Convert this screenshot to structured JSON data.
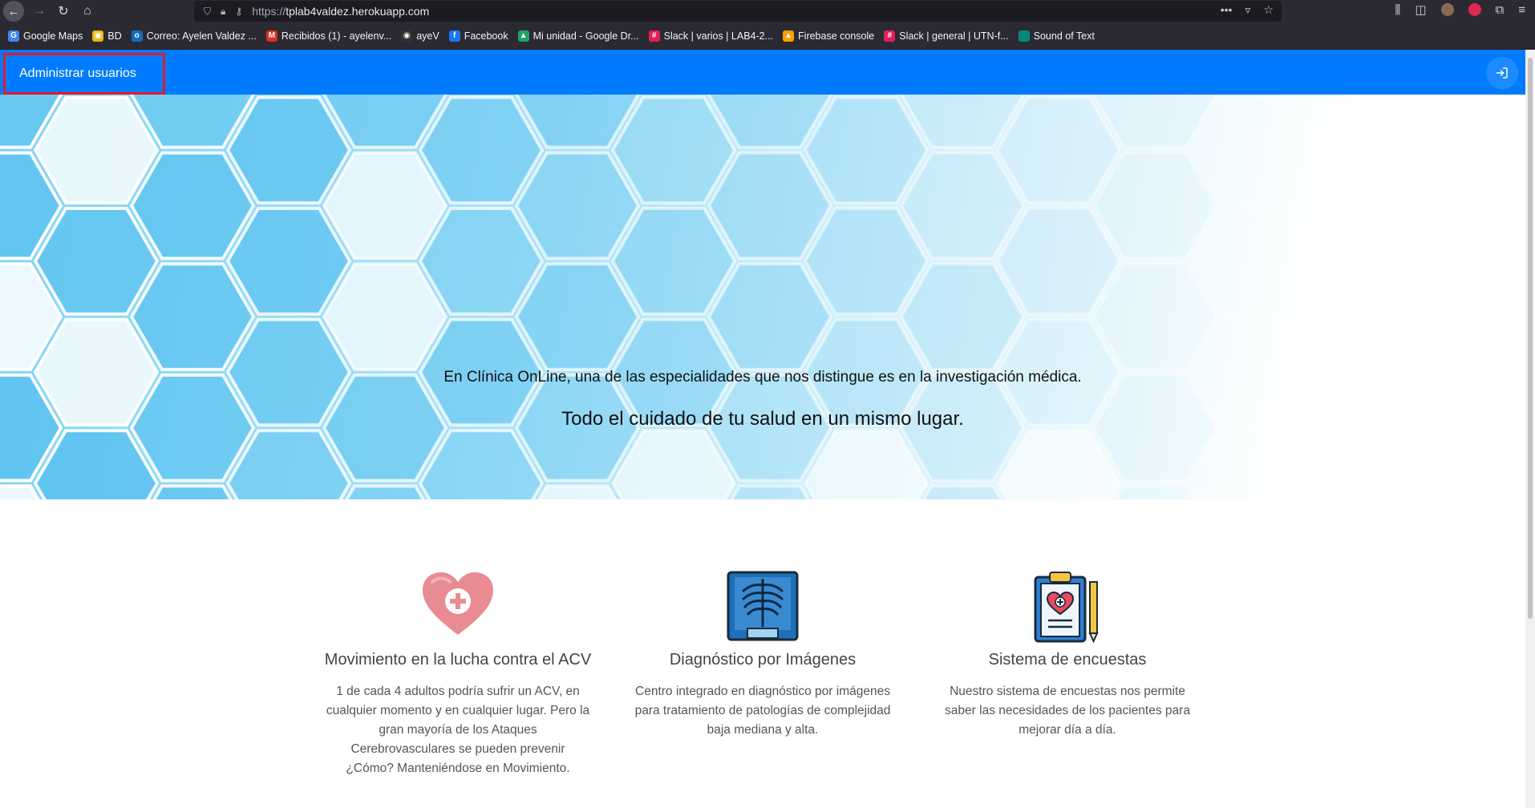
{
  "browser": {
    "url_prefix": "https://",
    "url_host": "tplab4valdez.herokuapp.com",
    "bookmarks": [
      {
        "label": "Google Maps",
        "color": "#4285f4",
        "glyph": "G"
      },
      {
        "label": "BD",
        "color": "#e8b70f",
        "glyph": "▣"
      },
      {
        "label": "Correo: Ayelen Valdez ...",
        "color": "#0f6cbd",
        "glyph": "o"
      },
      {
        "label": "Recibidos (1) - ayelenv...",
        "color": "#d93025",
        "glyph": "M"
      },
      {
        "label": "ayeV",
        "color": "#333",
        "glyph": "◉"
      },
      {
        "label": "Facebook",
        "color": "#1877f2",
        "glyph": "f"
      },
      {
        "label": "Mi unidad - Google Dr...",
        "color": "#1fa463",
        "glyph": "▲"
      },
      {
        "label": "Slack | varios | LAB4-2...",
        "color": "#e01e5a",
        "glyph": "#"
      },
      {
        "label": "Firebase console",
        "color": "#ffa000",
        "glyph": "▲"
      },
      {
        "label": "Slack | general | UTN-f...",
        "color": "#e01e5a",
        "glyph": "#"
      },
      {
        "label": "Sound of Text",
        "color": "#00897b",
        "glyph": " "
      }
    ]
  },
  "navbar": {
    "manage_users": "Administrar usuarios"
  },
  "hero": {
    "subtitle": "En Clínica OnLine, una de las especialidades que nos distingue es en la investigación médica.",
    "title": "Todo el cuidado de tu salud en un mismo lugar."
  },
  "features": [
    {
      "icon": "heart-plus-icon",
      "title": "Movimiento en la lucha contra el ACV",
      "text": "1 de cada 4 adultos podría sufrir un ACV, en cualquier momento y en cualquier lugar. Pero la gran mayoría de los Ataques Cerebrovasculares se pueden prevenir ¿Cómo? Manteniéndose en Movimiento."
    },
    {
      "icon": "xray-icon",
      "title": "Diagnóstico por Imágenes",
      "text": "Centro integrado en diagnóstico por imágenes para tratamiento de patologías de complejidad baja mediana y alta."
    },
    {
      "icon": "clipboard-heart-icon",
      "title": "Sistema de encuestas",
      "text": "Nuestro sistema de encuestas nos permite saber las necesidades de los pacientes para mejorar día a día."
    }
  ]
}
